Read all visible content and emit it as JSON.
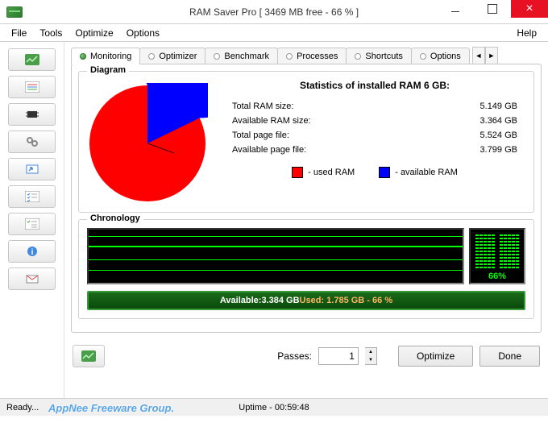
{
  "window": {
    "title": "RAM Saver Pro [ 3469 MB free - 66 % ]"
  },
  "menu": {
    "file": "File",
    "tools": "Tools",
    "optimize": "Optimize",
    "options": "Options",
    "help": "Help"
  },
  "tabs": {
    "monitoring": "Monitoring",
    "optimizer": "Optimizer",
    "benchmark": "Benchmark",
    "processes": "Processes",
    "shortcuts": "Shortcuts",
    "options": "Options"
  },
  "diagram": {
    "label": "Diagram",
    "stats_title": "Statistics of installed RAM 6 GB:",
    "rows": {
      "total_ram": {
        "label": "Total RAM size:",
        "value": "5.149 GB"
      },
      "avail_ram": {
        "label": "Available RAM size:",
        "value": "3.364 GB"
      },
      "total_page": {
        "label": "Total page file:",
        "value": "5.524 GB"
      },
      "avail_page": {
        "label": "Available page file:",
        "value": "3.799 GB"
      }
    },
    "legend": {
      "used": "- used RAM",
      "avail": "- available RAM"
    }
  },
  "chronology": {
    "label": "Chronology",
    "percent": "66%"
  },
  "avail_bar": {
    "avail_label": "Available: ",
    "avail_value": "3.384 GB",
    "used_label": "  Used: ",
    "used_value": "1.785 GB - 66 %"
  },
  "bottom": {
    "passes_label": "Passes:",
    "passes_value": "1",
    "optimize": "Optimize",
    "done": "Done"
  },
  "status": {
    "ready": "Ready...",
    "watermark": "AppNee Freeware Group.",
    "uptime": "Uptime - 00:59:48"
  },
  "colors": {
    "used": "#ff0000",
    "avail": "#0000ff"
  },
  "chart_data": {
    "type": "pie",
    "title": "Statistics of installed RAM 6 GB:",
    "series": [
      {
        "name": "used RAM",
        "value": 1.785,
        "color": "#ff0000"
      },
      {
        "name": "available RAM",
        "value": 3.364,
        "color": "#0000ff"
      }
    ],
    "unit": "GB",
    "percent_available": 66
  }
}
